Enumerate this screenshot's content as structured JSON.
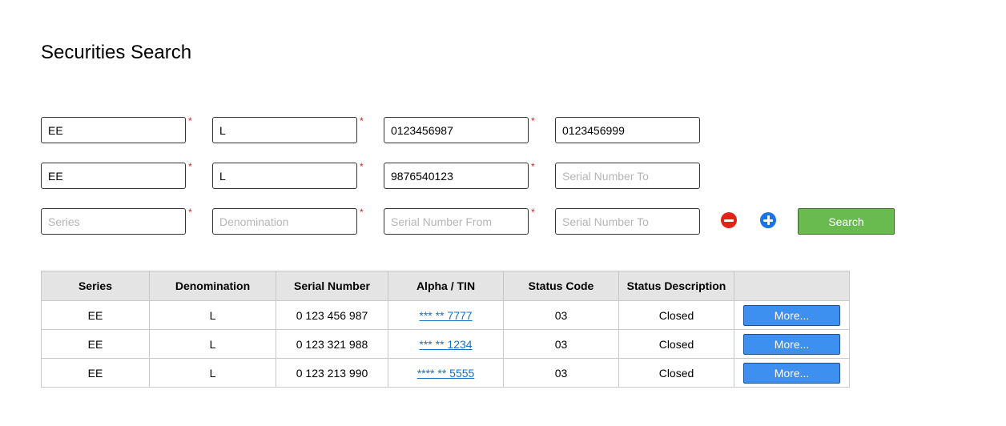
{
  "page": {
    "title": "Securities Search"
  },
  "form": {
    "required_mark": "*",
    "rows": [
      {
        "series": "EE",
        "denomination": "L",
        "serial_from": "0123456987",
        "serial_to": "0123456999"
      },
      {
        "series": "EE",
        "denomination": "L",
        "serial_from": "9876540123",
        "serial_to": ""
      },
      {
        "series": "",
        "denomination": "",
        "serial_from": "",
        "serial_to": ""
      }
    ],
    "placeholders": {
      "series": "Series",
      "denomination": "Denomination",
      "serial_from": "Serial Number From",
      "serial_to": "Serial Number To"
    },
    "remove_icon": "minus-circle-icon",
    "add_icon": "plus-circle-icon",
    "search_label": "Search"
  },
  "colors": {
    "search_button": "#6abb4f",
    "more_button": "#3d8ff0",
    "remove_icon": "#e2231a",
    "add_icon": "#1a73e8",
    "link": "#1a6fc9",
    "required": "#e02020"
  },
  "table": {
    "headers": [
      "Series",
      "Denomination",
      "Serial Number",
      "Alpha / TIN",
      "Status Code",
      "Status Description",
      ""
    ],
    "rows": [
      {
        "series": "EE",
        "denomination": "L",
        "serial": "0 123 456 987",
        "tin": "*** ** 7777",
        "status_code": "03",
        "status_desc": "Closed",
        "action": "More..."
      },
      {
        "series": "EE",
        "denomination": "L",
        "serial": "0 123 321 988",
        "tin": "*** ** 1234",
        "status_code": "03",
        "status_desc": "Closed",
        "action": "More..."
      },
      {
        "series": "EE",
        "denomination": "L",
        "serial": "0 123 213 990",
        "tin": "**** ** 5555",
        "status_code": "03",
        "status_desc": "Closed",
        "action": "More..."
      }
    ]
  }
}
